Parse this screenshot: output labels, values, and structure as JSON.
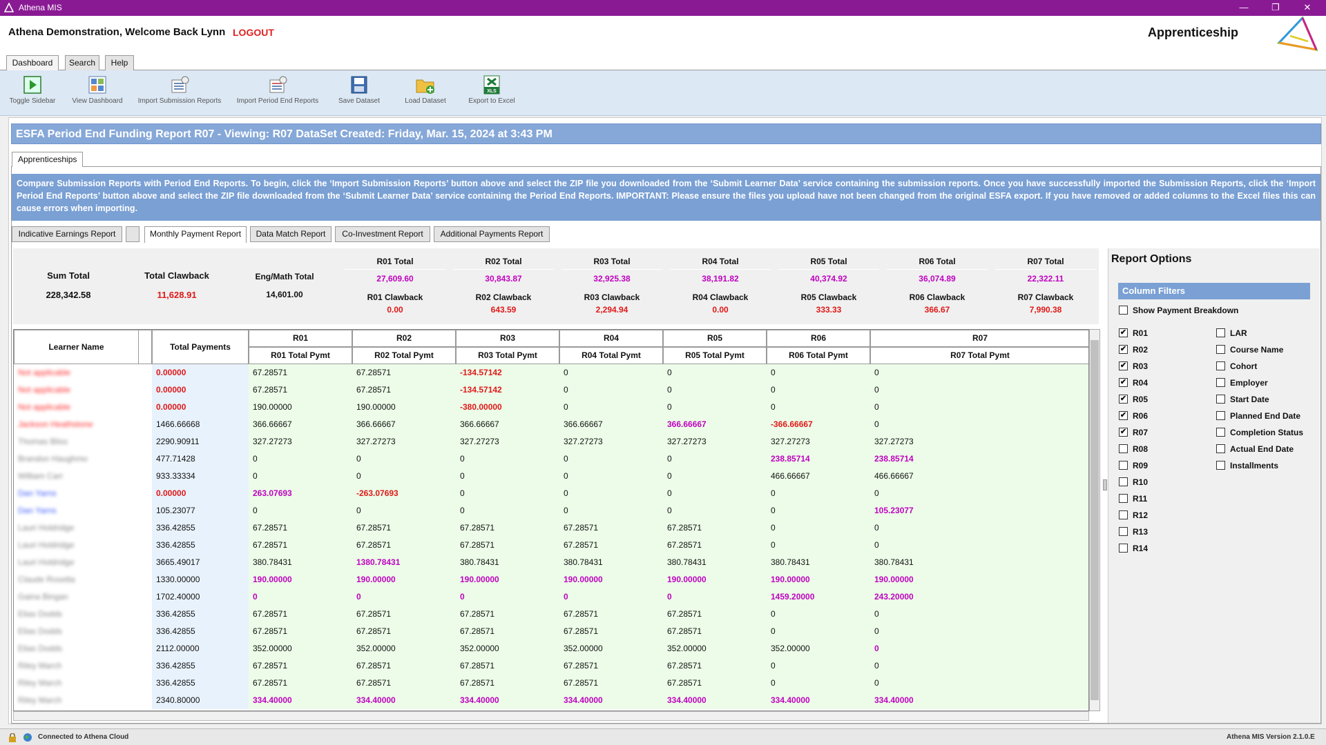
{
  "window": {
    "title": "Athena MIS"
  },
  "header": {
    "welcome": "Athena Demonstration,  Welcome Back Lynn",
    "logout": "LOGOUT",
    "module": "Apprenticeship"
  },
  "tabs": [
    {
      "label": "Dashboard"
    },
    {
      "label": "Search"
    },
    {
      "label": "Help"
    }
  ],
  "toolbar": [
    {
      "label": "Toggle Sidebar",
      "icon": "toggle-sidebar-icon"
    },
    {
      "label": "View Dashboard",
      "icon": "dashboard-icon"
    },
    {
      "label": "Import Submission Reports",
      "icon": "import-submission-icon"
    },
    {
      "label": "Import Period End Reports",
      "icon": "import-period-end-icon"
    },
    {
      "label": "Save Dataset",
      "icon": "save-icon"
    },
    {
      "label": "Load Dataset",
      "icon": "load-folder-icon"
    },
    {
      "label": "Export to Excel",
      "icon": "excel-icon"
    }
  ],
  "report": {
    "title": "ESFA Period End Funding Report R07   - Viewing: R07 DataSet Created: Friday, Mar. 15, 2024 at 3:43 PM",
    "subtab": "Apprenticeships",
    "info": "Compare Submission Reports with Period End Reports. To begin, click the ‘Import Submission Reports’ button above and select the ZIP file you downloaded from the ‘Submit Learner Data’ service containing the submission reports. Once you have successfully imported the Submission Reports, click the ‘Import Period End Reports’ button above and select the ZIP file downloaded from the ‘Submit Learner Data’ service containing the Period End Reports. IMPORTANT: Please ensure the files you upload have not been changed from the original ESFA export. If you have removed or added columns to the Excel files this can cause errors when importing.",
    "report_tabs": [
      "Indicative Earnings Report",
      "",
      "Monthly Payment Report",
      "Data Match Report",
      "Co-Investment Report",
      "Additional Payments Report"
    ],
    "active_tab": "Monthly Payment Report"
  },
  "summary": {
    "sum_total_label": "Sum Total",
    "sum_total": "228,342.58",
    "clawback_label": "Total Clawback",
    "clawback": "11,628.91",
    "engmath_label": "Eng/Math Total",
    "engmath": "14,601.00",
    "periods": [
      {
        "total_label": "R01 Total",
        "total": "27,609.60",
        "claw_label": "R01 Clawback",
        "claw": "0.00"
      },
      {
        "total_label": "R02 Total",
        "total": "30,843.87",
        "claw_label": "R02 Clawback",
        "claw": "643.59"
      },
      {
        "total_label": "R03 Total",
        "total": "32,925.38",
        "claw_label": "R03 Clawback",
        "claw": "2,294.94"
      },
      {
        "total_label": "R04 Total",
        "total": "38,191.82",
        "claw_label": "R04 Clawback",
        "claw": "0.00"
      },
      {
        "total_label": "R05 Total",
        "total": "40,374.92",
        "claw_label": "R05 Clawback",
        "claw": "333.33"
      },
      {
        "total_label": "R06 Total",
        "total": "36,074.89",
        "claw_label": "R06 Clawback",
        "claw": "366.67"
      },
      {
        "total_label": "R07 Total",
        "total": "22,322.11",
        "claw_label": "R07 Clawback",
        "claw": "7,990.38"
      }
    ]
  },
  "grid": {
    "name_header": "Learner Name",
    "total_header": "Total Payments",
    "period_headers": [
      "R01",
      "R02",
      "R03",
      "R04",
      "R05",
      "R06",
      "R07"
    ],
    "sub_headers": [
      "R01 Total Pymt",
      "R02 Total Pymt",
      "R03 Total Pymt",
      "R04 Total Pymt",
      "R05 Total Pymt",
      "R06 Total Pymt",
      "R07 Total Pymt"
    ],
    "rows": [
      {
        "name": "Not applicable",
        "name_color": "#ff3030",
        "total": "0.00000",
        "total_style": "neg",
        "vals": [
          "67.28571",
          "67.28571",
          "-134.57142",
          "0",
          "0",
          "0",
          "0"
        ],
        "styles": [
          "",
          "",
          "neg",
          "",
          "",
          "",
          ""
        ]
      },
      {
        "name": "Not applicable",
        "name_color": "#ff3030",
        "total": "0.00000",
        "total_style": "neg",
        "vals": [
          "67.28571",
          "67.28571",
          "-134.57142",
          "0",
          "0",
          "0",
          "0"
        ],
        "styles": [
          "",
          "",
          "neg",
          "",
          "",
          "",
          ""
        ]
      },
      {
        "name": "Not applicable",
        "name_color": "#ff3030",
        "total": "0.00000",
        "total_style": "neg",
        "vals": [
          "190.00000",
          "190.00000",
          "-380.00000",
          "0",
          "0",
          "0",
          "0"
        ],
        "styles": [
          "",
          "",
          "neg",
          "",
          "",
          "",
          ""
        ]
      },
      {
        "name": "Jackson Heathstone",
        "name_color": "#ff3030",
        "total": "1466.66668",
        "total_style": "",
        "vals": [
          "366.66667",
          "366.66667",
          "366.66667",
          "366.66667",
          "366.66667",
          "-366.66667",
          "0"
        ],
        "styles": [
          "",
          "",
          "",
          "",
          "mag",
          "neg",
          ""
        ]
      },
      {
        "name": "Thomas Bliss",
        "name_color": "#888",
        "total": "2290.90911",
        "total_style": "",
        "vals": [
          "327.27273",
          "327.27273",
          "327.27273",
          "327.27273",
          "327.27273",
          "327.27273",
          "327.27273"
        ],
        "styles": [
          "",
          "",
          "",
          "",
          "",
          "",
          ""
        ]
      },
      {
        "name": "Brandon Haughmo",
        "name_color": "#888",
        "total": "477.71428",
        "total_style": "",
        "vals": [
          "0",
          "0",
          "0",
          "0",
          "0",
          "238.85714",
          "238.85714"
        ],
        "styles": [
          "",
          "",
          "",
          "",
          "",
          "mag",
          "mag"
        ]
      },
      {
        "name": "William Carr",
        "name_color": "#888",
        "total": "933.33334",
        "total_style": "",
        "vals": [
          "0",
          "0",
          "0",
          "0",
          "0",
          "466.66667",
          "466.66667"
        ],
        "styles": [
          "",
          "",
          "",
          "",
          "",
          "",
          ""
        ]
      },
      {
        "name": "Dan Yarns",
        "name_color": "#4060ff",
        "total": "0.00000",
        "total_style": "neg",
        "vals": [
          "263.07693",
          "-263.07693",
          "0",
          "0",
          "0",
          "0",
          "0"
        ],
        "styles": [
          "mag",
          "neg",
          "",
          "",
          "",
          "",
          ""
        ]
      },
      {
        "name": "Dan Yarns",
        "name_color": "#4060ff",
        "total": "105.23077",
        "total_style": "",
        "vals": [
          "0",
          "0",
          "0",
          "0",
          "0",
          "0",
          "105.23077"
        ],
        "styles": [
          "",
          "",
          "",
          "",
          "",
          "",
          "mag"
        ]
      },
      {
        "name": "Lauri Holdridge",
        "name_color": "#888",
        "total": "336.42855",
        "total_style": "",
        "vals": [
          "67.28571",
          "67.28571",
          "67.28571",
          "67.28571",
          "67.28571",
          "0",
          "0"
        ],
        "styles": [
          "",
          "",
          "",
          "",
          "",
          "",
          ""
        ]
      },
      {
        "name": "Lauri Holdridge",
        "name_color": "#888",
        "total": "336.42855",
        "total_style": "",
        "vals": [
          "67.28571",
          "67.28571",
          "67.28571",
          "67.28571",
          "67.28571",
          "0",
          "0"
        ],
        "styles": [
          "",
          "",
          "",
          "",
          "",
          "",
          ""
        ]
      },
      {
        "name": "Lauri Holdridge",
        "name_color": "#888",
        "total": "3665.49017",
        "total_style": "",
        "vals": [
          "380.78431",
          "1380.78431",
          "380.78431",
          "380.78431",
          "380.78431",
          "380.78431",
          "380.78431"
        ],
        "styles": [
          "",
          "mag",
          "",
          "",
          "",
          "",
          ""
        ]
      },
      {
        "name": "Claude Rosetta",
        "name_color": "#888",
        "total": "1330.00000",
        "total_style": "",
        "vals": [
          "190.00000",
          "190.00000",
          "190.00000",
          "190.00000",
          "190.00000",
          "190.00000",
          "190.00000"
        ],
        "styles": [
          "mag",
          "mag",
          "mag",
          "mag",
          "mag",
          "mag",
          "mag"
        ]
      },
      {
        "name": "Gaina Bingan",
        "name_color": "#888",
        "total": "1702.40000",
        "total_style": "",
        "vals": [
          "0",
          "0",
          "0",
          "0",
          "0",
          "1459.20000",
          "243.20000"
        ],
        "styles": [
          "mag",
          "mag",
          "mag",
          "mag",
          "mag",
          "mag",
          "mag"
        ]
      },
      {
        "name": "Elias Dodds",
        "name_color": "#888",
        "total": "336.42855",
        "total_style": "",
        "vals": [
          "67.28571",
          "67.28571",
          "67.28571",
          "67.28571",
          "67.28571",
          "0",
          "0"
        ],
        "styles": [
          "",
          "",
          "",
          "",
          "",
          "",
          ""
        ]
      },
      {
        "name": "Elias Dodds",
        "name_color": "#888",
        "total": "336.42855",
        "total_style": "",
        "vals": [
          "67.28571",
          "67.28571",
          "67.28571",
          "67.28571",
          "67.28571",
          "0",
          "0"
        ],
        "styles": [
          "",
          "",
          "",
          "",
          "",
          "",
          ""
        ]
      },
      {
        "name": "Elias Dodds",
        "name_color": "#888",
        "total": "2112.00000",
        "total_style": "",
        "vals": [
          "352.00000",
          "352.00000",
          "352.00000",
          "352.00000",
          "352.00000",
          "352.00000",
          "0"
        ],
        "styles": [
          "",
          "",
          "",
          "",
          "",
          "",
          "mag"
        ]
      },
      {
        "name": "Riley March",
        "name_color": "#888",
        "total": "336.42855",
        "total_style": "",
        "vals": [
          "67.28571",
          "67.28571",
          "67.28571",
          "67.28571",
          "67.28571",
          "0",
          "0"
        ],
        "styles": [
          "",
          "",
          "",
          "",
          "",
          "",
          ""
        ]
      },
      {
        "name": "Riley March",
        "name_color": "#888",
        "total": "336.42855",
        "total_style": "",
        "vals": [
          "67.28571",
          "67.28571",
          "67.28571",
          "67.28571",
          "67.28571",
          "0",
          "0"
        ],
        "styles": [
          "",
          "",
          "",
          "",
          "",
          "",
          ""
        ]
      },
      {
        "name": "Riley March",
        "name_color": "#888",
        "total": "2340.80000",
        "total_style": "",
        "vals": [
          "334.40000",
          "334.40000",
          "334.40000",
          "334.40000",
          "334.40000",
          "334.40000",
          "334.40000"
        ],
        "styles": [
          "mag",
          "mag",
          "mag",
          "mag",
          "mag",
          "mag",
          "mag"
        ]
      }
    ]
  },
  "options": {
    "title": "Report Options",
    "filters_label": "Column Filters",
    "show_breakdown": {
      "label": "Show Payment Breakdown",
      "checked": false
    },
    "left": [
      {
        "label": "R01",
        "checked": true
      },
      {
        "label": "R02",
        "checked": true
      },
      {
        "label": "R03",
        "checked": true
      },
      {
        "label": "R04",
        "checked": true
      },
      {
        "label": "R05",
        "checked": true
      },
      {
        "label": "R06",
        "checked": true
      },
      {
        "label": "R07",
        "checked": true
      },
      {
        "label": "R08",
        "checked": false
      },
      {
        "label": "R09",
        "checked": false
      },
      {
        "label": "R10",
        "checked": false
      },
      {
        "label": "R11",
        "checked": false
      },
      {
        "label": "R12",
        "checked": false
      },
      {
        "label": "R13",
        "checked": false
      },
      {
        "label": "R14",
        "checked": false
      }
    ],
    "right": [
      {
        "label": "LAR",
        "checked": false
      },
      {
        "label": "Course Name",
        "checked": false
      },
      {
        "label": "Cohort",
        "checked": false
      },
      {
        "label": "Employer",
        "checked": false
      },
      {
        "label": "Start Date",
        "checked": false
      },
      {
        "label": "Planned End Date",
        "checked": false
      },
      {
        "label": "Completion Status",
        "checked": false
      },
      {
        "label": "Actual End Date",
        "checked": false
      },
      {
        "label": "Installments",
        "checked": false
      }
    ]
  },
  "status": {
    "connection": "Connected to Athena Cloud",
    "version": "Athena MIS Version 2.1.0.E"
  },
  "colors": {
    "titlebar": "#8a1a94",
    "negative": "#e01818",
    "highlight": "#c000c0",
    "accent_blue": "#7aa0d4"
  }
}
